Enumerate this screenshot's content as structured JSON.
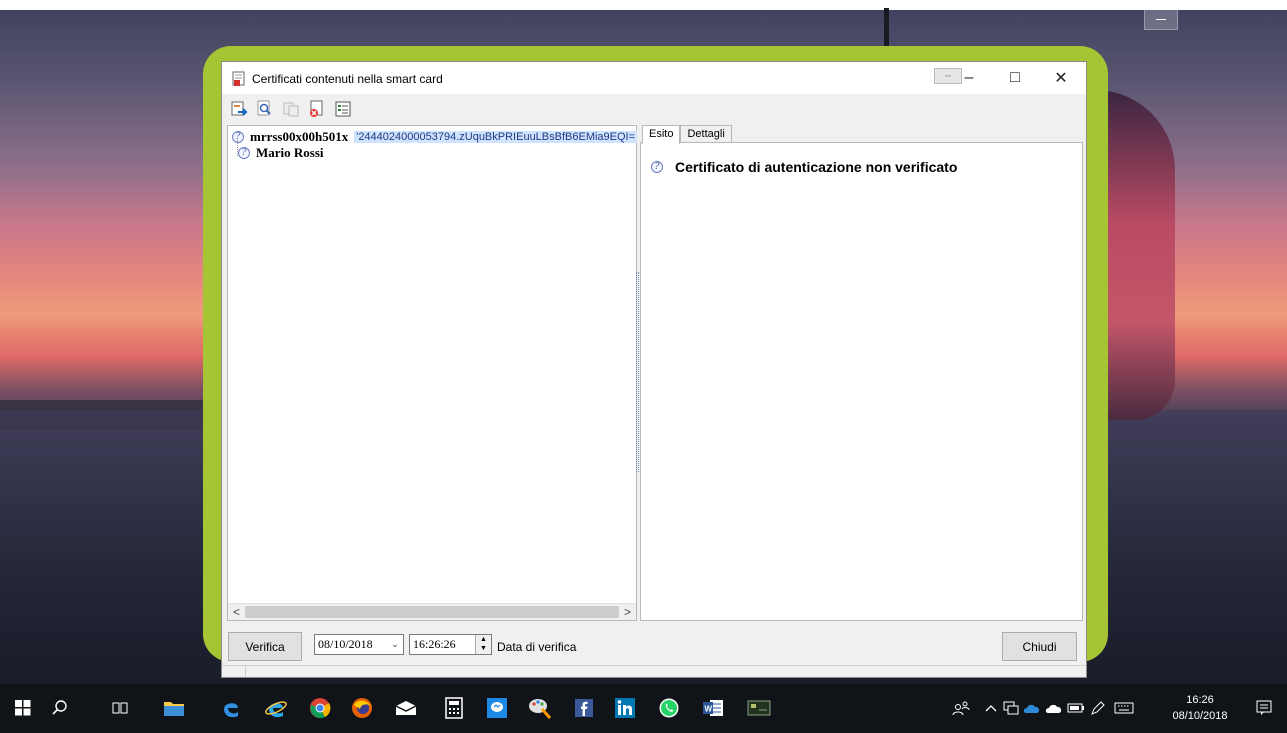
{
  "window": {
    "title": "Certificati contenuti nella smart card",
    "minimize_glyph": "–",
    "maximize_glyph": "□",
    "close_glyph": "✕"
  },
  "tree": {
    "items": [
      {
        "name": "mrrss00x00h501x",
        "serial": "'2444024000053794.zUquBkPRIEuuLBsBfB6EMia9EQI="
      },
      {
        "name": "Mario Rossi"
      }
    ]
  },
  "tabs": [
    {
      "label": "Esito"
    },
    {
      "label": "Dettagli"
    }
  ],
  "result": {
    "message": "Certificato di autenticazione non verificato"
  },
  "controls": {
    "verify_label": "Verifica",
    "date_value": "08/10/2018",
    "time_value": "16:26:26",
    "date_label": "Data di verifica",
    "close_label": "Chiudi"
  },
  "scrollbar": {
    "left_arrow": "<",
    "right_arrow": ">"
  },
  "taskbar": {
    "time": "16:26",
    "date": "08/10/2018"
  },
  "colors": {
    "frame_accent": "#a6c534",
    "selection": "#cfe3ff",
    "taskbar": "#101418"
  }
}
